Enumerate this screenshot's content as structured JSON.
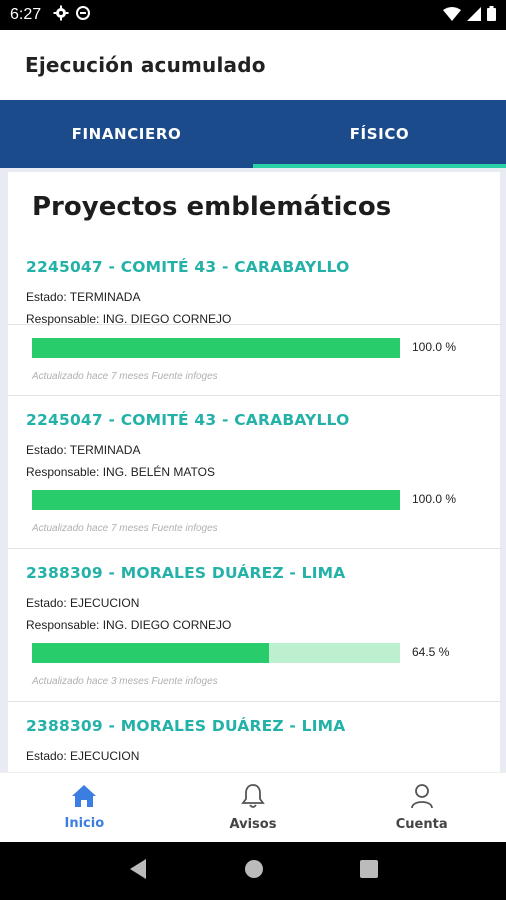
{
  "status_bar": {
    "time": "6:27"
  },
  "header": {
    "title": "Ejecución acumulado"
  },
  "tabs": [
    {
      "label": "FINANCIERO",
      "active": false
    },
    {
      "label": "FÍSICO",
      "active": true
    }
  ],
  "section": {
    "title": "Proyectos emblemáticos"
  },
  "projects": [
    {
      "title": "2245047 - COMITÉ 43 - CARABAYLLO",
      "estado": "Estado: TERMINADA",
      "responsable": "Responsable: ING. DIEGO CORNEJO",
      "progress": 100.0,
      "percent_text": "100.0 %",
      "note": "Actualizado hace 7 meses Fuente infoges"
    },
    {
      "title": "2245047 - COMITÉ 43 - CARABAYLLO",
      "estado": "Estado: TERMINADA",
      "responsable": "Responsable: ING. BELÉN MATOS",
      "progress": 100.0,
      "percent_text": "100.0 %",
      "note": "Actualizado hace 7 meses Fuente infoges"
    },
    {
      "title": "2388309 - MORALES DUÁREZ - LIMA",
      "estado": "Estado: EJECUCION",
      "responsable": "Responsable: ING. DIEGO CORNEJO",
      "progress": 64.5,
      "percent_text": "64.5 %",
      "note": "Actualizado hace 3 meses Fuente infoges"
    },
    {
      "title": "2388309 - MORALES DUÁREZ - LIMA",
      "estado": "Estado: EJECUCION"
    }
  ],
  "bottom_nav": [
    {
      "label": "Inicio",
      "icon": "home-icon",
      "active": true
    },
    {
      "label": "Avisos",
      "icon": "bell-icon",
      "active": false
    },
    {
      "label": "Cuenta",
      "icon": "user-icon",
      "active": false
    }
  ],
  "colors": {
    "tab_bar": "#1c4b8b",
    "tab_indicator": "#2ad0a8",
    "project_title": "#23b1a8",
    "progress_fill": "#28cc6a",
    "progress_track": "#bdf0cf",
    "nav_active": "#3b7de1"
  }
}
